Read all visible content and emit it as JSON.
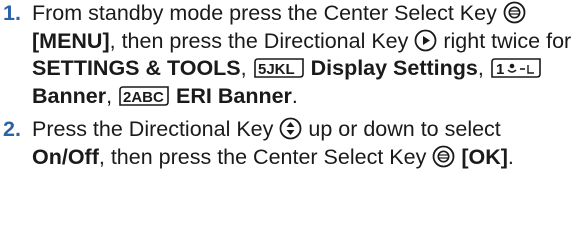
{
  "step1": {
    "number": "1.",
    "t1": "From standby mode press the Center Select Key",
    "menu": "[MENU]",
    "t2": ", then press the Directional Key",
    "t3": "right twice for",
    "settings_tools": "SETTINGS & TOOLS",
    "comma": ",",
    "key5": "5JKL",
    "display_settings": "Display Settings",
    "key1": "1",
    "banner": "Banner",
    "key2": "2ABC",
    "eri_banner": "ERI Banner",
    "end": "."
  },
  "step2": {
    "number": "2.",
    "t1": "Press the Directional Key",
    "t2": "up or down to select",
    "onoff": "On/Off",
    "t3": ", then press the Center Select Key",
    "ok": "[OK]",
    "end": "."
  },
  "icons": {
    "center_select": "center-select-key-icon",
    "directional_right": "directional-right-key-icon",
    "directional_updown": "directional-updown-key-icon",
    "key_5": "keypad-5-icon",
    "key_1": "keypad-1-icon",
    "key_2": "keypad-2-icon"
  },
  "colors": {
    "step_number": "#2a63aa",
    "text": "#1a1a1a"
  }
}
